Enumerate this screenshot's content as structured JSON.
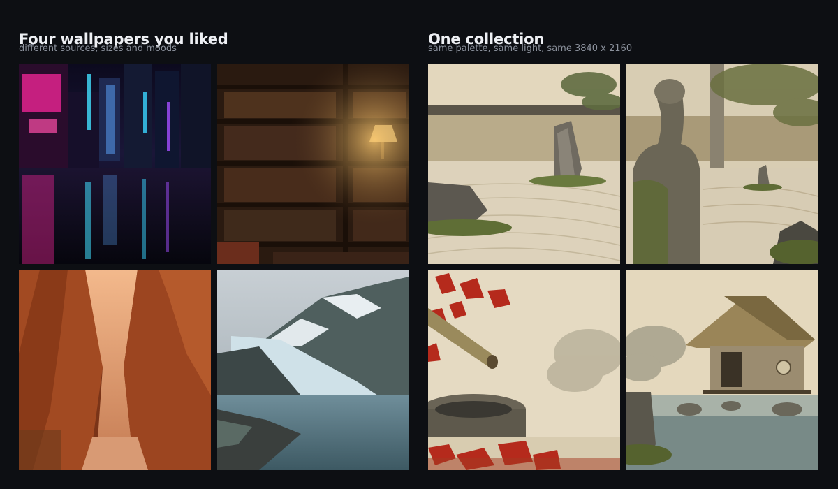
{
  "left": {
    "title": "Four wallpapers you liked",
    "subtitle": "different sources, sizes and moods"
  },
  "right": {
    "title": "One collection",
    "subtitle": "same palette, same light, same 3840 x 2160"
  },
  "colors": {
    "background": "#0d0f13",
    "title": "#eef0f4",
    "subtitle": "#8b919c"
  }
}
